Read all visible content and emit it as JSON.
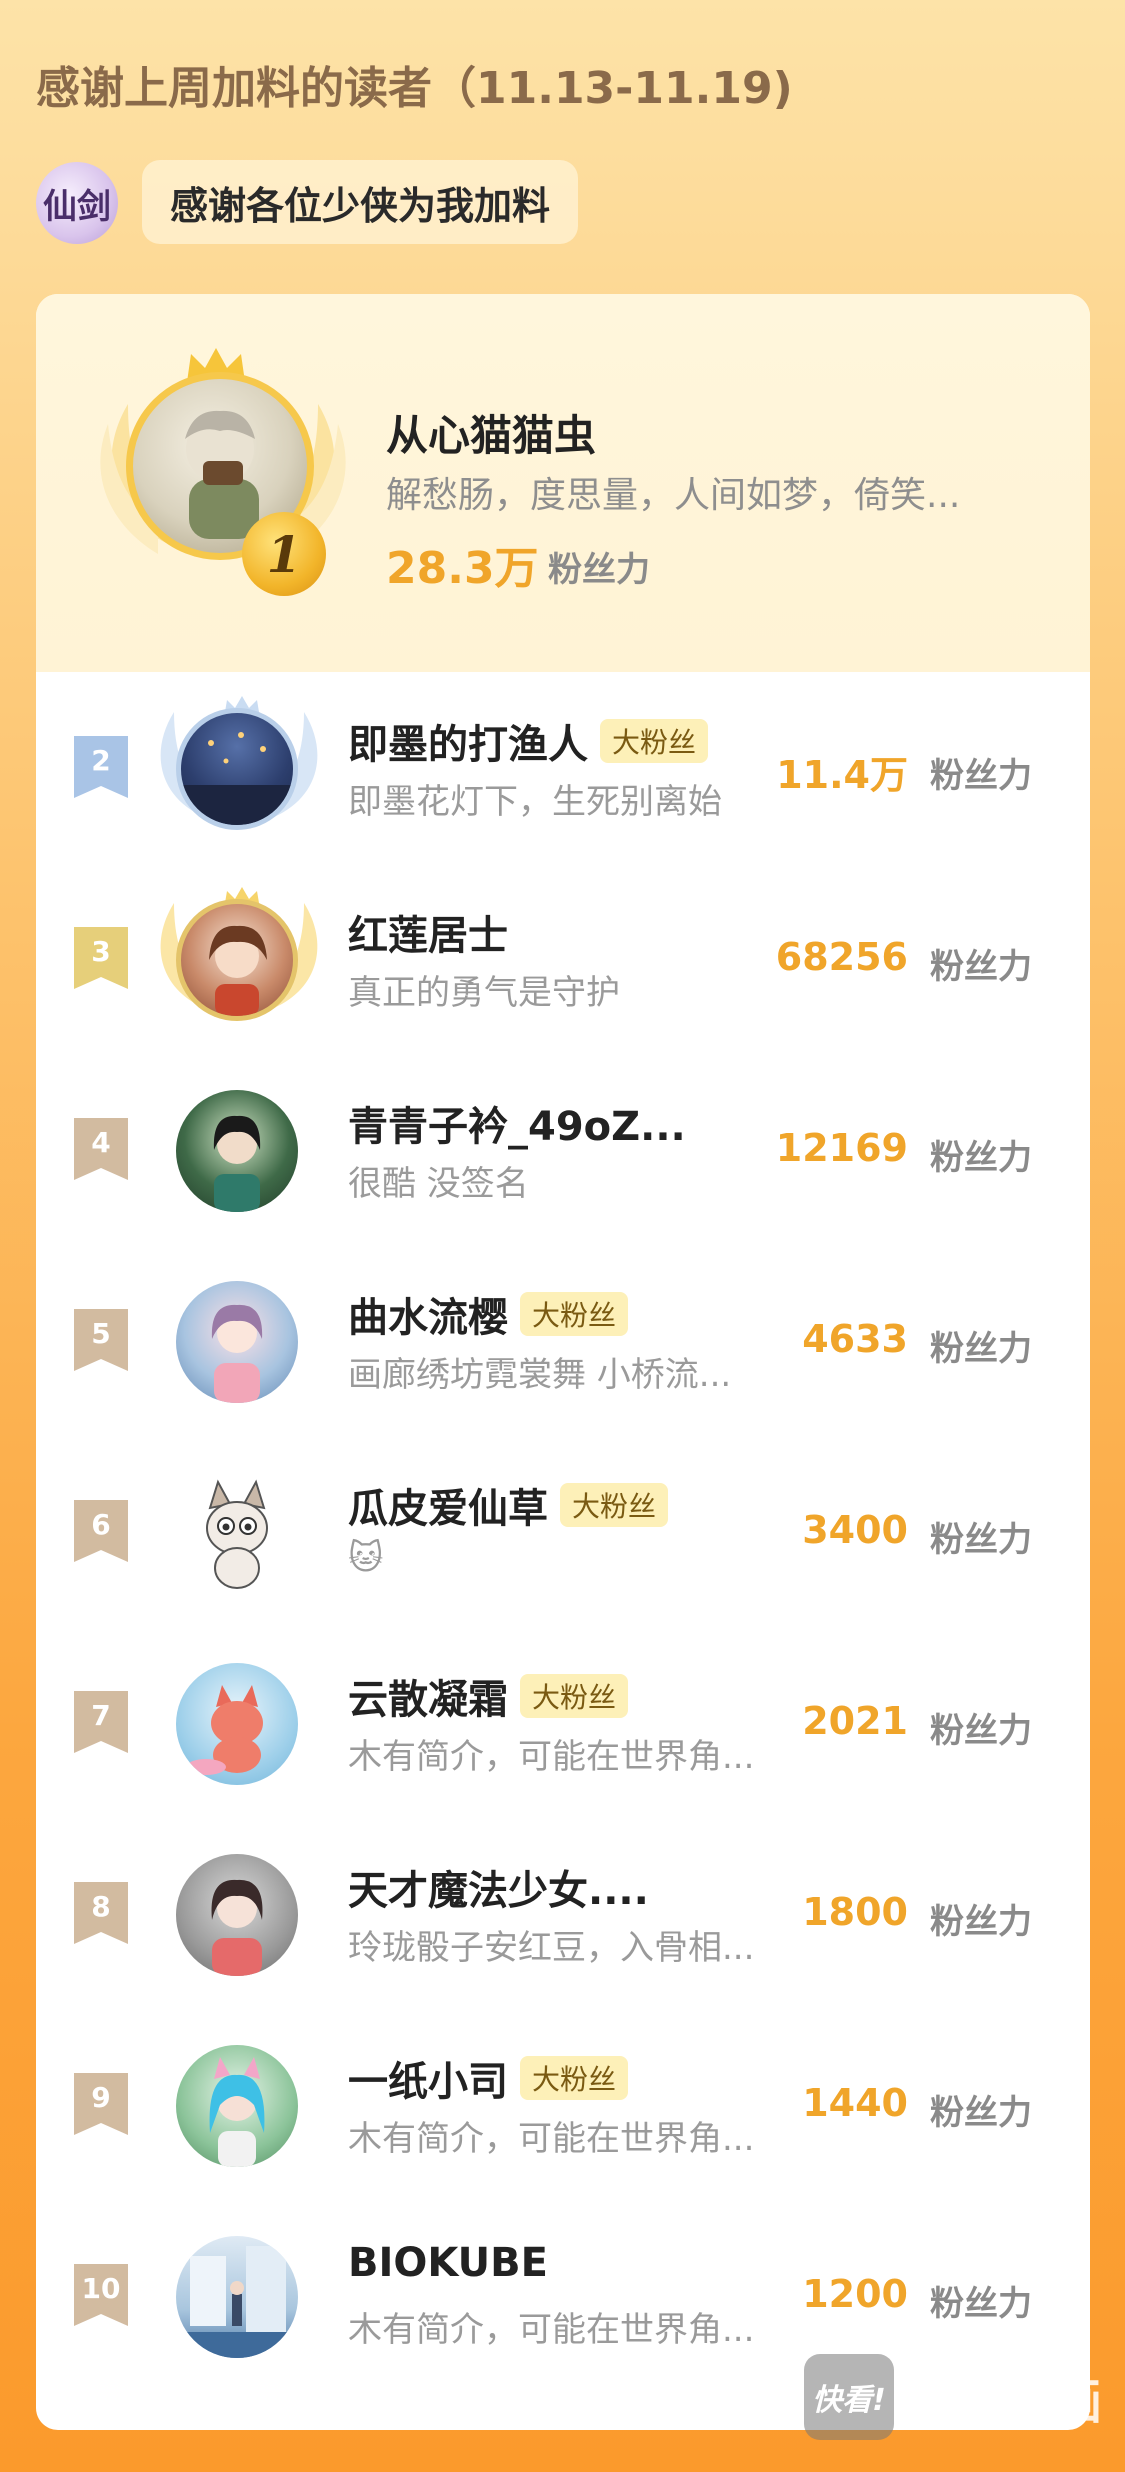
{
  "header": {
    "title": "感谢上周加料的读者（11.13-11.19)",
    "host_avatar_text": "仙剑",
    "host_message": "感谢各位少侠为我加料"
  },
  "top1": {
    "rank": "1",
    "name": "从心猫猫虫",
    "desc": "解愁肠，度思量，人间如梦，倚笑...",
    "score": "28.3万",
    "unit": "粉丝力"
  },
  "rows": [
    {
      "rank": "2",
      "name": "即墨的打渔人",
      "badge": "大粉丝",
      "desc": "即墨花灯下，生死别离始",
      "score": "11.4万",
      "unit": "粉丝力"
    },
    {
      "rank": "3",
      "name": "红莲居士",
      "badge": "",
      "desc": "真正的勇气是守护",
      "score": "68256",
      "unit": "粉丝力"
    },
    {
      "rank": "4",
      "name": "青青子衿_49oZ...",
      "badge": "",
      "desc": "很酷 没签名",
      "score": "12169",
      "unit": "粉丝力"
    },
    {
      "rank": "5",
      "name": "曲水流樱",
      "badge": "大粉丝",
      "desc": "画廊绣坊霓裳舞 小桥流...",
      "score": "4633",
      "unit": "粉丝力"
    },
    {
      "rank": "6",
      "name": "瓜皮爱仙草",
      "badge": "大粉丝",
      "desc": "🐱",
      "score": "3400",
      "unit": "粉丝力"
    },
    {
      "rank": "7",
      "name": "云散凝霜",
      "badge": "大粉丝",
      "desc": "木有简介，可能在世界角...",
      "score": "2021",
      "unit": "粉丝力"
    },
    {
      "rank": "8",
      "name": "天才魔法少女....",
      "badge": "",
      "desc": "玲珑骰子安红豆，入骨相...",
      "score": "1800",
      "unit": "粉丝力"
    },
    {
      "rank": "9",
      "name": "一纸小司",
      "badge": "大粉丝",
      "desc": "木有简介，可能在世界角...",
      "score": "1440",
      "unit": "粉丝力"
    },
    {
      "rank": "10",
      "name": "BIOKUBE",
      "badge": "",
      "desc": "木有简介，可能在世界角...",
      "score": "1200",
      "unit": "粉丝力"
    }
  ],
  "watermark": {
    "logo_text": "快看!",
    "brand": "快看漫画"
  },
  "colors": {
    "accent": "#f0a52a",
    "rank2": "#a9c4e6",
    "rank3": "#e6cf7a",
    "rank_other": "#d2bba0"
  }
}
